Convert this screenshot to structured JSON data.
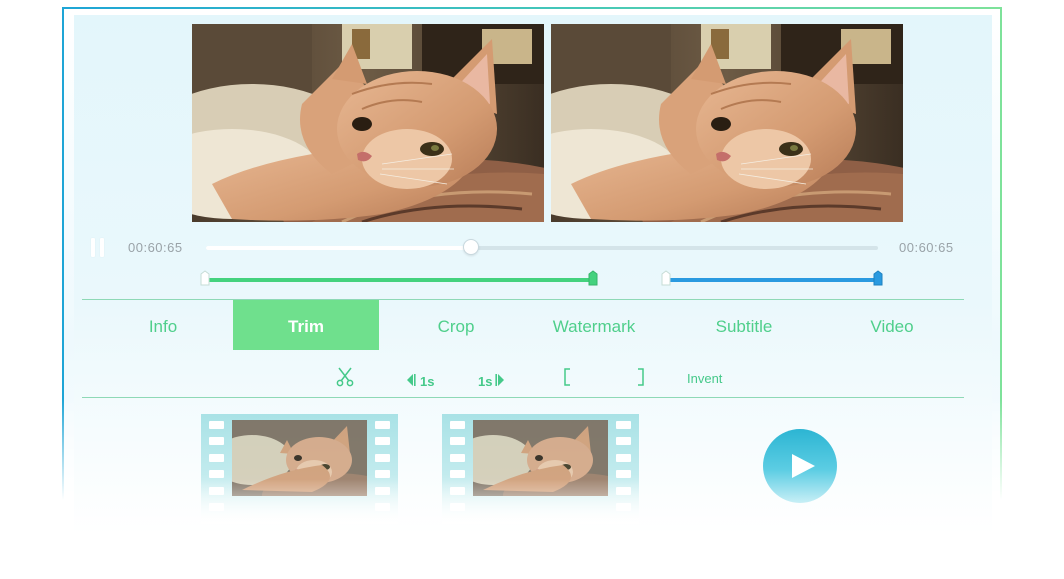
{
  "player": {
    "time_current": "00:60:65",
    "time_total": "00:60:65",
    "progress": 0.395,
    "trim_range_1": {
      "start": 0.0,
      "end": 0.579
    },
    "trim_range_2": {
      "start": 0.686,
      "end": 1.0
    }
  },
  "tabs": [
    {
      "label": "Info",
      "active": false
    },
    {
      "label": "Trim",
      "active": true
    },
    {
      "label": "Crop",
      "active": false
    },
    {
      "label": "Watermark",
      "active": false
    },
    {
      "label": "Subtitle",
      "active": false
    },
    {
      "label": "Video",
      "active": false
    }
  ],
  "tools": {
    "cut_icon": "scissors-icon",
    "step_back_label": "1s",
    "step_forward_label": "1s",
    "set_start_icon": "left-bracket-icon",
    "set_end_icon": "right-bracket-icon",
    "invent_label": "Invent"
  },
  "icons": {
    "pause": "pause-icon",
    "play": "play-icon"
  },
  "colors": {
    "accent_green": "#44d27e",
    "accent_blue": "#2a9ae0",
    "tab_active_bg": "#6fe08d",
    "play_button": "#2cb5d3"
  }
}
